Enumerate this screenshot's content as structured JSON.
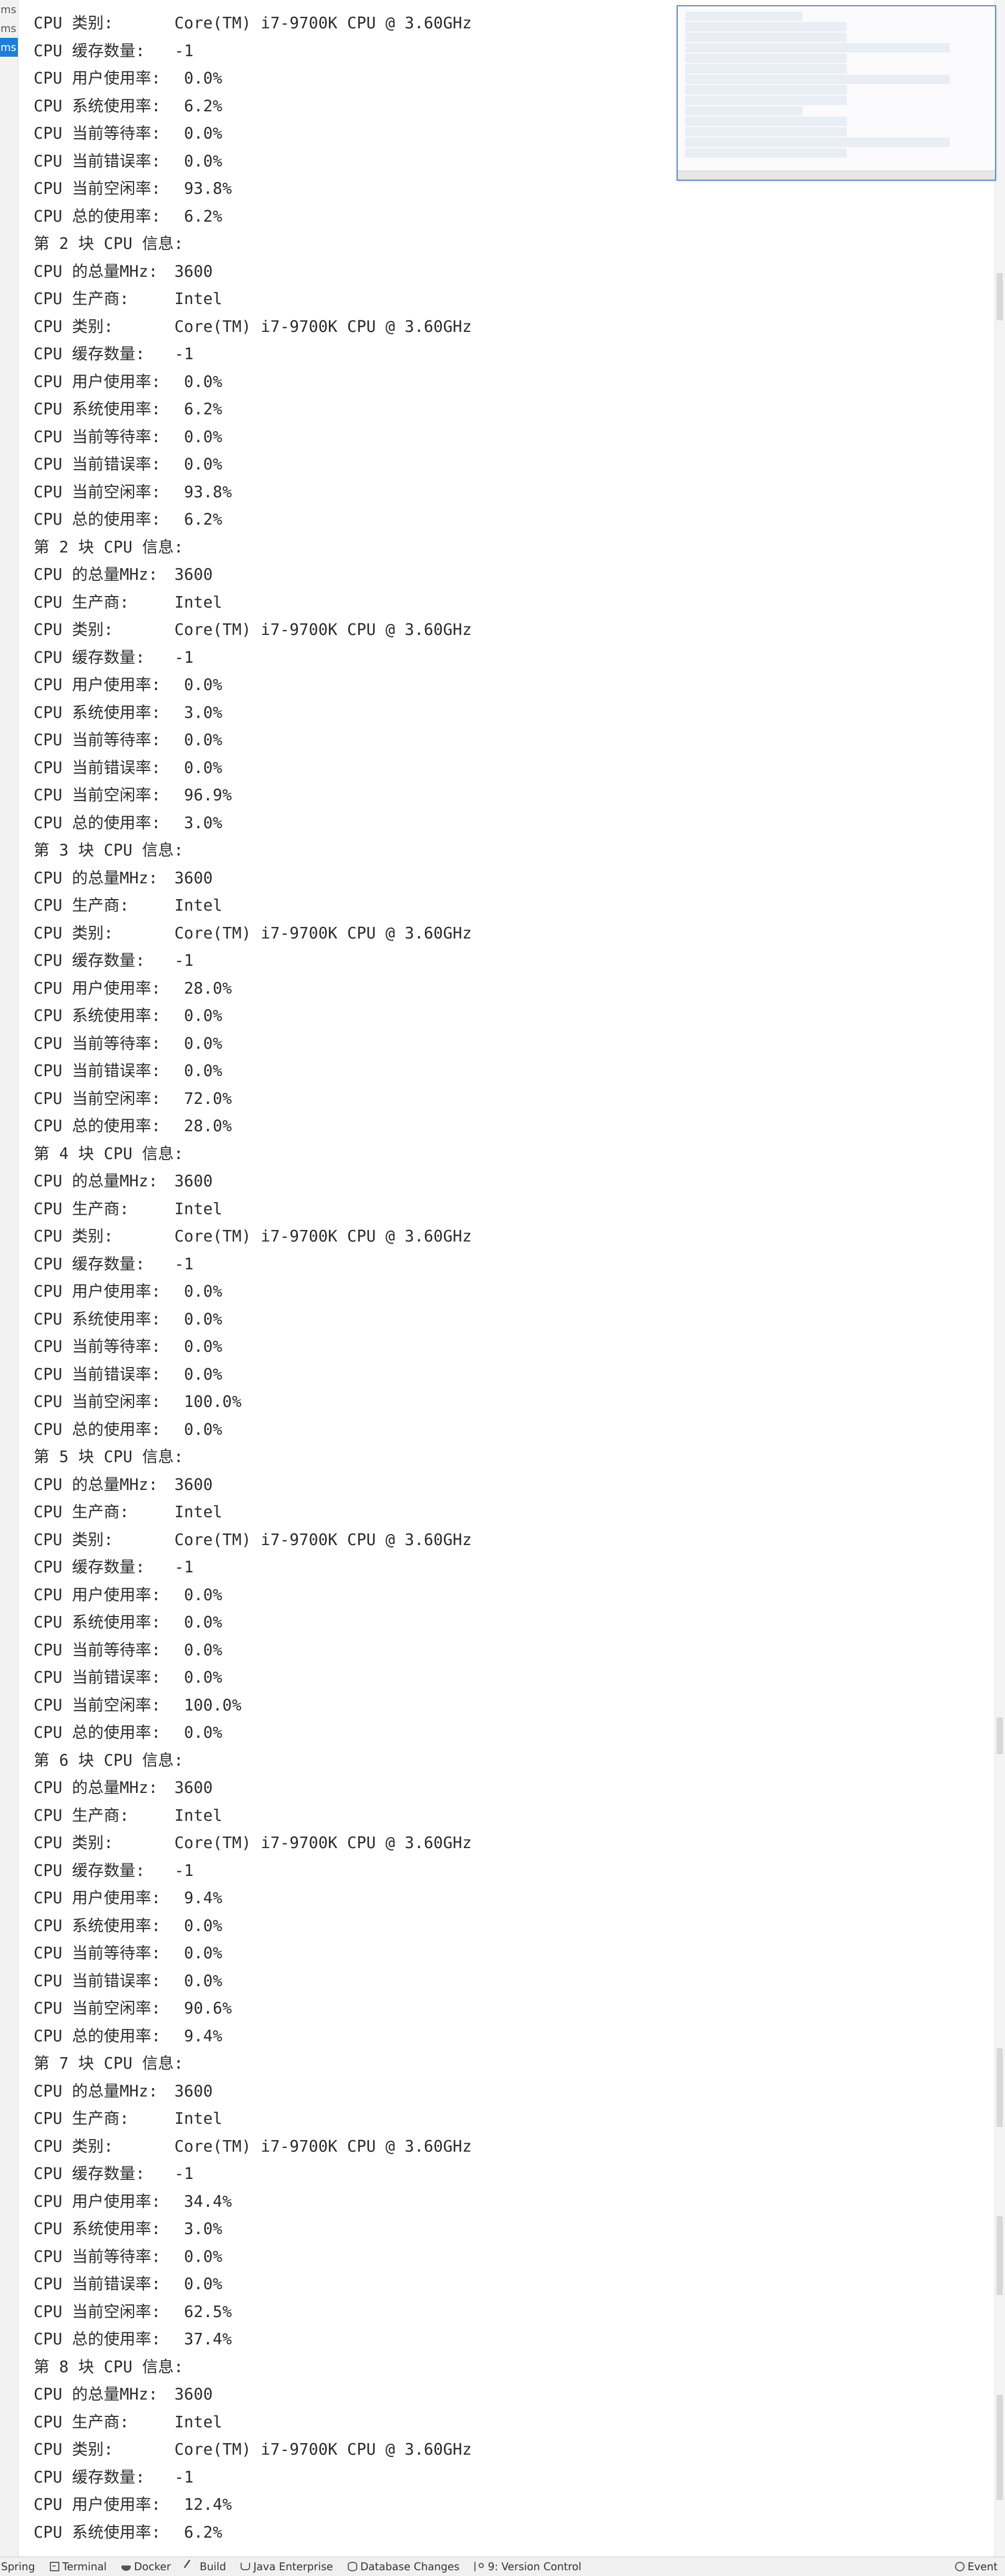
{
  "left_gutter": {
    "items": [
      {
        "label": "ms",
        "selected": false
      },
      {
        "label": "ms",
        "selected": false
      },
      {
        "label": "ms",
        "selected": true
      }
    ]
  },
  "console": {
    "lines": [
      {
        "label": "CPU 类别:",
        "value": "Core(TM) i7-9700K CPU @ 3.60GHz"
      },
      {
        "label": "CPU 缓存数量:",
        "value": "-1"
      },
      {
        "label": "CPU 用户使用率:",
        "value": " 0.0%"
      },
      {
        "label": "CPU 系统使用率:",
        "value": " 6.2%"
      },
      {
        "label": "CPU 当前等待率:",
        "value": " 0.0%"
      },
      {
        "label": "CPU 当前错误率:",
        "value": " 0.0%"
      },
      {
        "label": "CPU 当前空闲率:",
        "value": " 93.8%"
      },
      {
        "label": "CPU 总的使用率:",
        "value": " 6.2%"
      },
      {
        "label": "第 2 块 CPU 信息:",
        "value": ""
      },
      {
        "label": "CPU 的总量MHz:",
        "value": "3600"
      },
      {
        "label": "CPU 生产商:",
        "value": "Intel"
      },
      {
        "label": "CPU 类别:",
        "value": "Core(TM) i7-9700K CPU @ 3.60GHz"
      },
      {
        "label": "CPU 缓存数量:",
        "value": "-1"
      },
      {
        "label": "CPU 用户使用率:",
        "value": " 0.0%"
      },
      {
        "label": "CPU 系统使用率:",
        "value": " 6.2%"
      },
      {
        "label": "CPU 当前等待率:",
        "value": " 0.0%"
      },
      {
        "label": "CPU 当前错误率:",
        "value": " 0.0%"
      },
      {
        "label": "CPU 当前空闲率:",
        "value": " 93.8%"
      },
      {
        "label": "CPU 总的使用率:",
        "value": " 6.2%"
      },
      {
        "label": "第 2 块 CPU 信息:",
        "value": ""
      },
      {
        "label": "CPU 的总量MHz:",
        "value": "3600"
      },
      {
        "label": "CPU 生产商:",
        "value": "Intel"
      },
      {
        "label": "CPU 类别:",
        "value": "Core(TM) i7-9700K CPU @ 3.60GHz"
      },
      {
        "label": "CPU 缓存数量:",
        "value": "-1"
      },
      {
        "label": "CPU 用户使用率:",
        "value": " 0.0%"
      },
      {
        "label": "CPU 系统使用率:",
        "value": " 3.0%"
      },
      {
        "label": "CPU 当前等待率:",
        "value": " 0.0%"
      },
      {
        "label": "CPU 当前错误率:",
        "value": " 0.0%"
      },
      {
        "label": "CPU 当前空闲率:",
        "value": " 96.9%"
      },
      {
        "label": "CPU 总的使用率:",
        "value": " 3.0%"
      },
      {
        "label": "第 3 块 CPU 信息:",
        "value": ""
      },
      {
        "label": "CPU 的总量MHz:",
        "value": "3600"
      },
      {
        "label": "CPU 生产商:",
        "value": "Intel"
      },
      {
        "label": "CPU 类别:",
        "value": "Core(TM) i7-9700K CPU @ 3.60GHz"
      },
      {
        "label": "CPU 缓存数量:",
        "value": "-1"
      },
      {
        "label": "CPU 用户使用率:",
        "value": " 28.0%"
      },
      {
        "label": "CPU 系统使用率:",
        "value": " 0.0%"
      },
      {
        "label": "CPU 当前等待率:",
        "value": " 0.0%"
      },
      {
        "label": "CPU 当前错误率:",
        "value": " 0.0%"
      },
      {
        "label": "CPU 当前空闲率:",
        "value": " 72.0%"
      },
      {
        "label": "CPU 总的使用率:",
        "value": " 28.0%"
      },
      {
        "label": "第 4 块 CPU 信息:",
        "value": ""
      },
      {
        "label": "CPU 的总量MHz:",
        "value": "3600"
      },
      {
        "label": "CPU 生产商:",
        "value": "Intel"
      },
      {
        "label": "CPU 类别:",
        "value": "Core(TM) i7-9700K CPU @ 3.60GHz"
      },
      {
        "label": "CPU 缓存数量:",
        "value": "-1"
      },
      {
        "label": "CPU 用户使用率:",
        "value": " 0.0%"
      },
      {
        "label": "CPU 系统使用率:",
        "value": " 0.0%"
      },
      {
        "label": "CPU 当前等待率:",
        "value": " 0.0%"
      },
      {
        "label": "CPU 当前错误率:",
        "value": " 0.0%"
      },
      {
        "label": "CPU 当前空闲率:",
        "value": " 100.0%"
      },
      {
        "label": "CPU 总的使用率:",
        "value": " 0.0%"
      },
      {
        "label": "第 5 块 CPU 信息:",
        "value": ""
      },
      {
        "label": "CPU 的总量MHz:",
        "value": "3600"
      },
      {
        "label": "CPU 生产商:",
        "value": "Intel"
      },
      {
        "label": "CPU 类别:",
        "value": "Core(TM) i7-9700K CPU @ 3.60GHz"
      },
      {
        "label": "CPU 缓存数量:",
        "value": "-1"
      },
      {
        "label": "CPU 用户使用率:",
        "value": " 0.0%"
      },
      {
        "label": "CPU 系统使用率:",
        "value": " 0.0%"
      },
      {
        "label": "CPU 当前等待率:",
        "value": " 0.0%"
      },
      {
        "label": "CPU 当前错误率:",
        "value": " 0.0%"
      },
      {
        "label": "CPU 当前空闲率:",
        "value": " 100.0%"
      },
      {
        "label": "CPU 总的使用率:",
        "value": " 0.0%"
      },
      {
        "label": "第 6 块 CPU 信息:",
        "value": ""
      },
      {
        "label": "CPU 的总量MHz:",
        "value": "3600"
      },
      {
        "label": "CPU 生产商:",
        "value": "Intel"
      },
      {
        "label": "CPU 类别:",
        "value": "Core(TM) i7-9700K CPU @ 3.60GHz"
      },
      {
        "label": "CPU 缓存数量:",
        "value": "-1"
      },
      {
        "label": "CPU 用户使用率:",
        "value": " 9.4%"
      },
      {
        "label": "CPU 系统使用率:",
        "value": " 0.0%"
      },
      {
        "label": "CPU 当前等待率:",
        "value": " 0.0%"
      },
      {
        "label": "CPU 当前错误率:",
        "value": " 0.0%"
      },
      {
        "label": "CPU 当前空闲率:",
        "value": " 90.6%"
      },
      {
        "label": "CPU 总的使用率:",
        "value": " 9.4%"
      },
      {
        "label": "第 7 块 CPU 信息:",
        "value": ""
      },
      {
        "label": "CPU 的总量MHz:",
        "value": "3600"
      },
      {
        "label": "CPU 生产商:",
        "value": "Intel"
      },
      {
        "label": "CPU 类别:",
        "value": "Core(TM) i7-9700K CPU @ 3.60GHz"
      },
      {
        "label": "CPU 缓存数量:",
        "value": "-1"
      },
      {
        "label": "CPU 用户使用率:",
        "value": " 34.4%"
      },
      {
        "label": "CPU 系统使用率:",
        "value": " 3.0%"
      },
      {
        "label": "CPU 当前等待率:",
        "value": " 0.0%"
      },
      {
        "label": "CPU 当前错误率:",
        "value": " 0.0%"
      },
      {
        "label": "CPU 当前空闲率:",
        "value": " 62.5%"
      },
      {
        "label": "CPU 总的使用率:",
        "value": " 37.4%"
      },
      {
        "label": "第 8 块 CPU 信息:",
        "value": ""
      },
      {
        "label": "CPU 的总量MHz:",
        "value": "3600"
      },
      {
        "label": "CPU 生产商:",
        "value": "Intel"
      },
      {
        "label": "CPU 类别:",
        "value": "Core(TM) i7-9700K CPU @ 3.60GHz"
      },
      {
        "label": "CPU 缓存数量:",
        "value": "-1"
      },
      {
        "label": "CPU 用户使用率:",
        "value": " 12.4%"
      },
      {
        "label": "CPU 系统使用率:",
        "value": " 6.2%"
      }
    ]
  },
  "status_bar": {
    "items": [
      {
        "label": "Spring",
        "icon": "spring-icon"
      },
      {
        "label": "Terminal",
        "icon": "terminal-icon"
      },
      {
        "label": "Docker",
        "icon": "docker-icon"
      },
      {
        "label": "Build",
        "icon": "build-hammer-icon"
      },
      {
        "label": "Java Enterprise",
        "icon": "java-enterprise-icon"
      },
      {
        "label": "Database Changes",
        "icon": "database-icon"
      },
      {
        "label": "9: Version Control",
        "icon": "version-control-icon"
      }
    ],
    "right_item": {
      "label": "Event",
      "icon": "event-log-icon"
    }
  }
}
